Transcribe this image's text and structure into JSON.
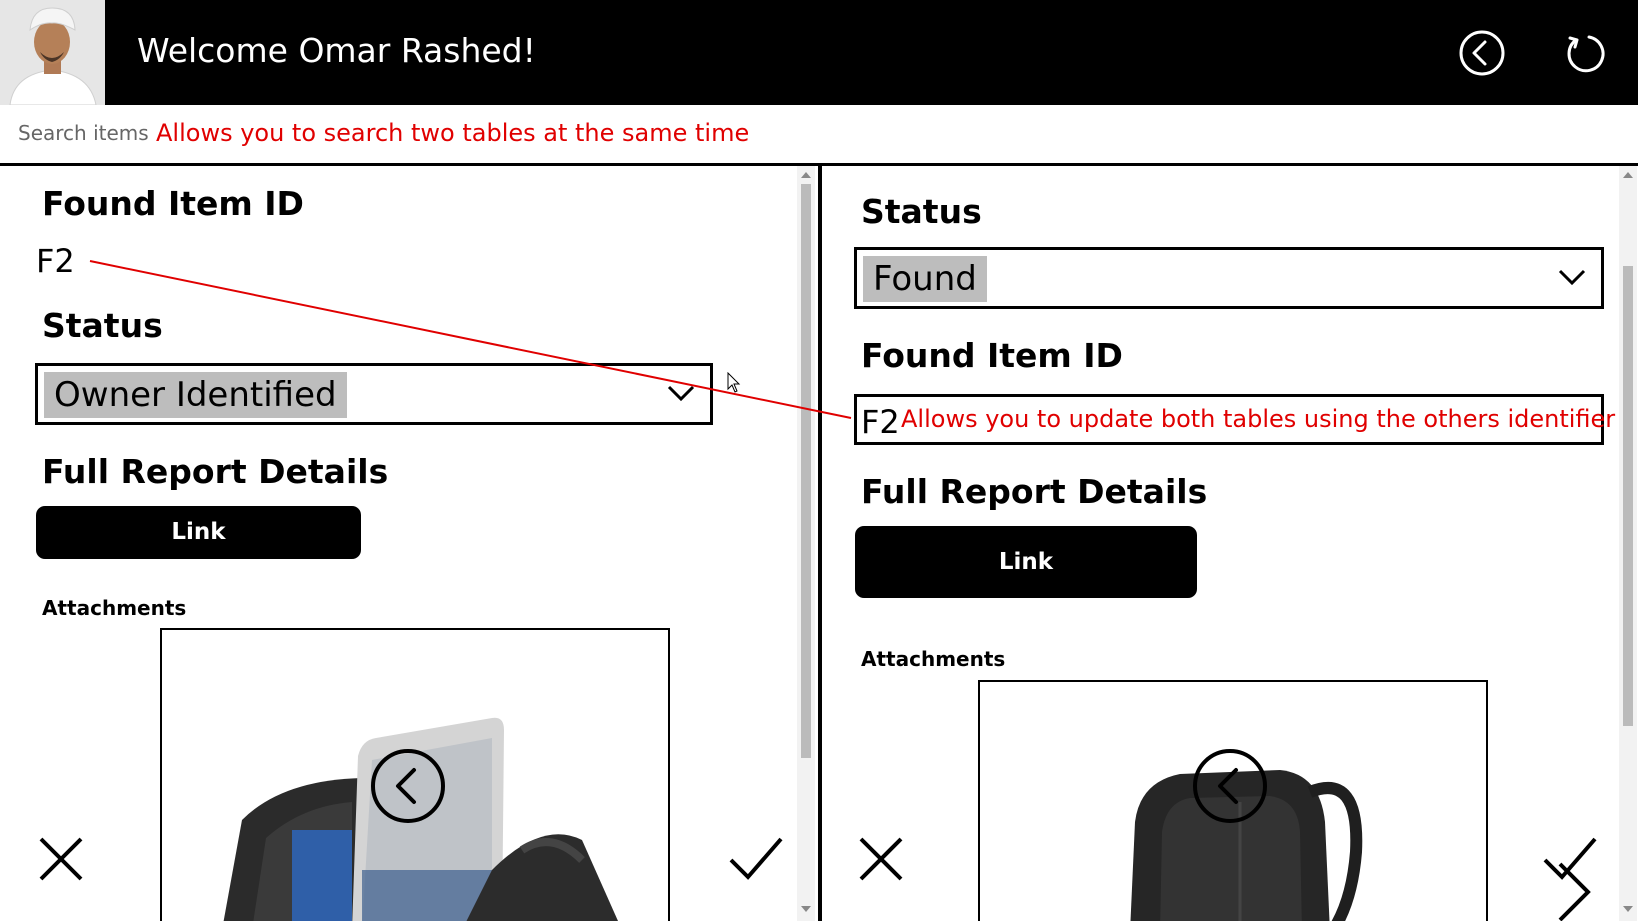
{
  "header": {
    "welcome": "Welcome Omar Rashed!"
  },
  "search": {
    "placeholder": "Search items",
    "annotation": "Allows you to search two tables at the same time"
  },
  "left_panel": {
    "found_item_id_label": "Found Item ID",
    "found_item_id_value": "F2",
    "status_label": "Status",
    "status_value": "Owner Identified",
    "report_label": "Full Report Details",
    "link_label": "Link",
    "attachments_label": "Attachments"
  },
  "right_panel": {
    "status_label": "Status",
    "status_value": "Found",
    "found_item_id_label": "Found Item ID",
    "found_item_id_value": "F2",
    "found_item_annotation": "Allows you to update both tables using the others identifier",
    "report_label": "Full Report Details",
    "link_label": "Link",
    "attachments_label": "Attachments"
  },
  "colors": {
    "annotation": "#e00000",
    "header_bg": "#000000",
    "selected_bg": "#bdbdbd"
  }
}
